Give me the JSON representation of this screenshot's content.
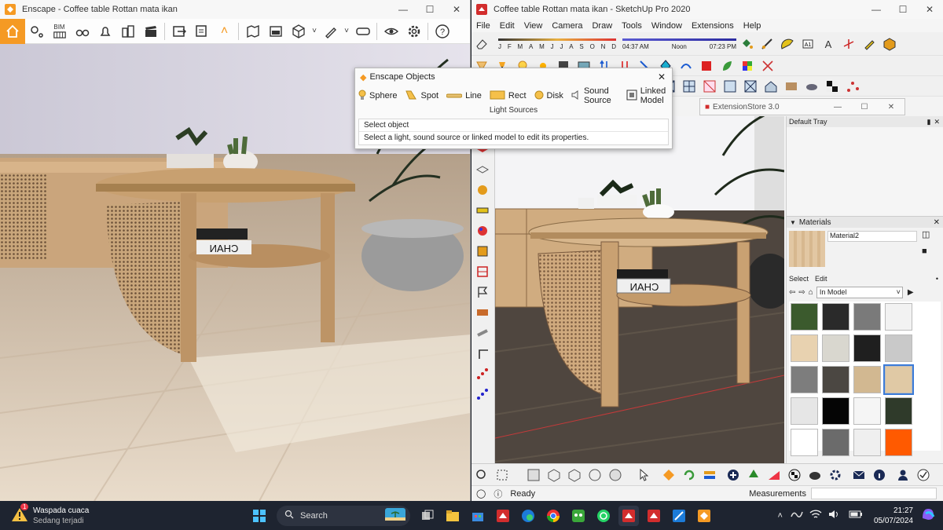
{
  "enscape": {
    "title": "Enscape - Coffee table Rottan mata ikan",
    "toolbar_label": "BIM"
  },
  "sketchup": {
    "title": "Coffee table Rottan mata ikan - SketchUp Pro 2020",
    "menu": [
      "File",
      "Edit",
      "View",
      "Camera",
      "Draw",
      "Tools",
      "Window",
      "Extensions",
      "Help"
    ],
    "months": [
      "J",
      "F",
      "M",
      "A",
      "M",
      "J",
      "J",
      "A",
      "S",
      "O",
      "N",
      "D"
    ],
    "time_start": "04:37 AM",
    "time_noon": "Noon",
    "time_end": "07:23 PM",
    "status": "Ready",
    "measurements_label": "Measurements"
  },
  "enscape_objects": {
    "title": "Enscape Objects",
    "items": [
      "Sphere",
      "Spot",
      "Line",
      "Rect",
      "Disk",
      "Sound Source",
      "Linked Model"
    ],
    "group_label": "Light Sources",
    "select_object_label": "Select object",
    "hint": "Select a light, sound source or linked model to edit its properties."
  },
  "extension_store": {
    "title": "ExtensionStore 3.0"
  },
  "tray": {
    "title": "Default Tray",
    "materials_label": "Materials",
    "material_name": "Material2",
    "tab_select": "Select",
    "tab_edit": "Edit",
    "dropdown_value": "In Model",
    "swatches": [
      "#3b5a2d",
      "#2a2a2a",
      "#7a7a7a",
      "#f2f2f2",
      "#e8d2b0",
      "#d9d7cf",
      "#1f1f1f",
      "#c9c9c9",
      "#7d7d7d",
      "#4b4742",
      "#d2b891",
      "#e0c9a5",
      "#e6e6e6",
      "#050505",
      "#f5f5f5",
      "#2f3a2a",
      "#ffffff",
      "#6b6b6b",
      "#efefef",
      "#ff5a00"
    ]
  },
  "taskbar": {
    "weather_title": "Waspada cuaca",
    "weather_sub": "Sedang terjadi",
    "weather_badge": "1",
    "search_label": "Search",
    "time": "21:27",
    "date": "05/07/2024"
  },
  "colors": {
    "enscape_accent": "#f59a24",
    "taskbar_bg": "#1e2430",
    "sketchup_red": "#d22d2d"
  }
}
